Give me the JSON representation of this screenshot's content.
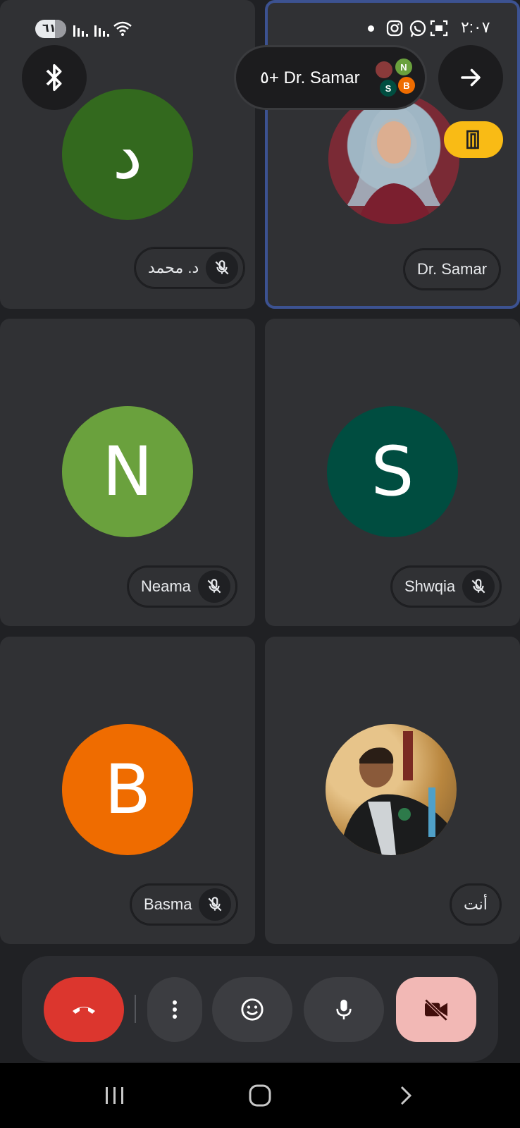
{
  "status_bar": {
    "time": "٢:٠٧",
    "battery": "٦١",
    "icons": [
      "dot-icon",
      "instagram-icon",
      "whatsapp-icon",
      "screenshot-icon"
    ]
  },
  "header": {
    "call_chip_label": "٥+ Dr. Samar",
    "mini_avatars": [
      {
        "letter": "N",
        "color": "#6aa13d"
      },
      {
        "letter": "S",
        "color": "#004d40"
      },
      {
        "letter": "B",
        "color": "#ef6c00"
      }
    ],
    "bluetooth_icon": "bluetooth-icon",
    "forward_icon": "arrow-right-icon"
  },
  "participants": [
    {
      "name": "د. محمد",
      "letter": "د",
      "color": "#33691e",
      "muted": true,
      "photo": false
    },
    {
      "name": "Dr. Samar",
      "letter": "",
      "color": "#7b2a2a",
      "muted": false,
      "photo": true,
      "active": true
    },
    {
      "name": "Neama",
      "letter": "N",
      "color": "#6aa13d",
      "muted": true,
      "photo": false
    },
    {
      "name": "Shwqia",
      "letter": "S",
      "color": "#004d40",
      "muted": true,
      "photo": false
    },
    {
      "name": "Basma",
      "letter": "B",
      "color": "#ef6c00",
      "muted": true,
      "photo": false
    },
    {
      "name": "أنت",
      "letter": "",
      "color": "#8a6a3a",
      "muted": false,
      "photo": true
    }
  ],
  "controls": {
    "end_call_icon": "phone-hangup-icon",
    "more_icon": "more-vert-icon",
    "emoji_icon": "emoji-icon",
    "mic_icon": "mic-icon",
    "camera_off_icon": "videocam-off-icon"
  },
  "colors": {
    "accent_border": "#3c5291",
    "end_call": "#dc362e",
    "camera_off_bg": "#f2b8b5",
    "exit_badge": "#f9bb15"
  }
}
